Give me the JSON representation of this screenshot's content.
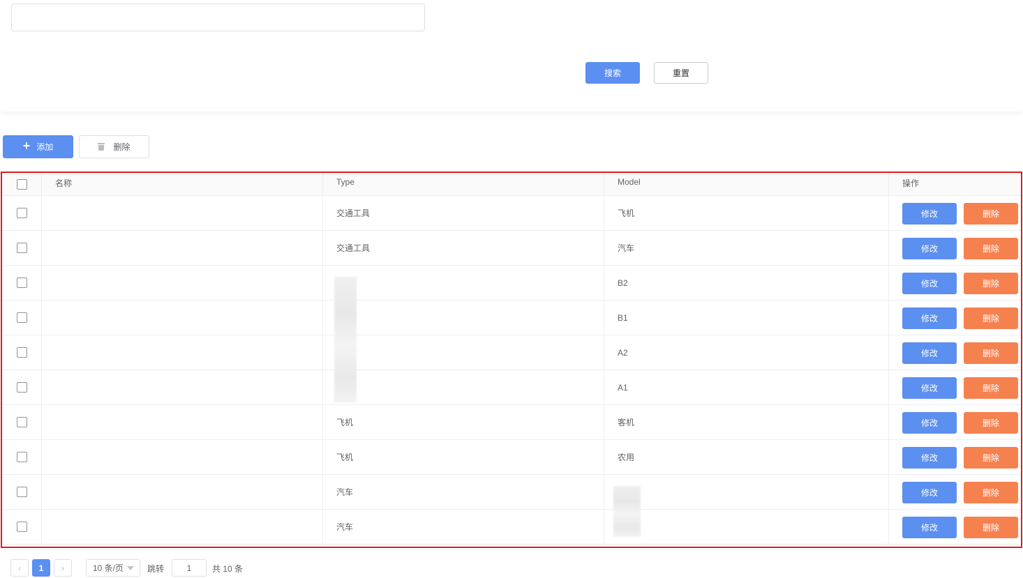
{
  "search": {
    "input_value": "",
    "search_label": "搜索",
    "reset_label": "重置"
  },
  "toolbar": {
    "add_label": "添加",
    "delete_label": "删除"
  },
  "table": {
    "headers": {
      "name": "名称",
      "type": "Type",
      "model": "Model",
      "ops": "操作"
    },
    "edit_label": "修改",
    "delete_label": "删除",
    "rows": [
      {
        "name": "",
        "type": "交通工具",
        "model": "飞机"
      },
      {
        "name": "",
        "type": "交通工具",
        "model": "汽车"
      },
      {
        "name": "",
        "type": "",
        "model": "B2"
      },
      {
        "name": "",
        "type": "",
        "model": "B1"
      },
      {
        "name": "",
        "type": "",
        "model": "A2"
      },
      {
        "name": "",
        "type": "",
        "model": "A1"
      },
      {
        "name": "",
        "type": "飞机",
        "model": "客机"
      },
      {
        "name": "",
        "type": "飞机",
        "model": "农用"
      },
      {
        "name": "",
        "type": "汽车",
        "model": ""
      },
      {
        "name": "",
        "type": "汽车",
        "model": ""
      }
    ]
  },
  "pagination": {
    "prev_icon": "‹",
    "current_page": "1",
    "next_icon": "›",
    "page_size": "10 条/页",
    "jump_label": "跳转",
    "jump_value": "1",
    "total": "共 10 条"
  }
}
